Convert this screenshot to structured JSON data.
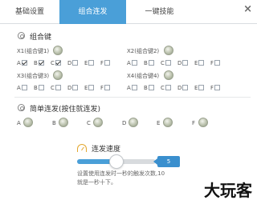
{
  "tabs": [
    {
      "label": "基础设置",
      "active": false
    },
    {
      "label": "组合连发",
      "active": true
    },
    {
      "label": "一键技能",
      "active": false
    }
  ],
  "close_icon": "×",
  "combo": {
    "title": "组合键",
    "groups": [
      {
        "label": "X1(组合键1)",
        "checks": [
          {
            "key": "A",
            "checked": true
          },
          {
            "key": "B",
            "checked": true
          },
          {
            "key": "C",
            "checked": true
          },
          {
            "key": "D",
            "checked": false
          },
          {
            "key": "E",
            "checked": false
          },
          {
            "key": "F",
            "checked": false
          }
        ]
      },
      {
        "label": "X2(组合键2)",
        "checks": [
          {
            "key": "A",
            "checked": false
          },
          {
            "key": "B",
            "checked": false
          },
          {
            "key": "C",
            "checked": false
          },
          {
            "key": "D",
            "checked": false
          },
          {
            "key": "E",
            "checked": false
          },
          {
            "key": "F",
            "checked": false
          }
        ]
      },
      {
        "label": "X3(组合键3)",
        "checks": [
          {
            "key": "A",
            "checked": false
          },
          {
            "key": "B",
            "checked": false
          },
          {
            "key": "C",
            "checked": false
          },
          {
            "key": "D",
            "checked": false
          },
          {
            "key": "E",
            "checked": false
          },
          {
            "key": "F",
            "checked": false
          }
        ]
      },
      {
        "label": "X4(组合键4)",
        "checks": [
          {
            "key": "A",
            "checked": false
          },
          {
            "key": "B",
            "checked": false
          },
          {
            "key": "C",
            "checked": false
          },
          {
            "key": "D",
            "checked": false
          },
          {
            "key": "E",
            "checked": false
          },
          {
            "key": "F",
            "checked": false
          }
        ]
      }
    ]
  },
  "turbo": {
    "title": "简单连发(按住就连发)",
    "keys": [
      "A",
      "B",
      "C",
      "D",
      "E",
      "F"
    ]
  },
  "speed": {
    "title": "连发速度",
    "value": "5",
    "level_fraction": 0.5,
    "desc_line1": "设置使用连发时一秒的触发次数,10",
    "desc_line2": "就是一秒十下。"
  },
  "watermark": "大玩客",
  "colors": {
    "accent": "#4a9fd8",
    "gauge": "#e3a72f"
  }
}
